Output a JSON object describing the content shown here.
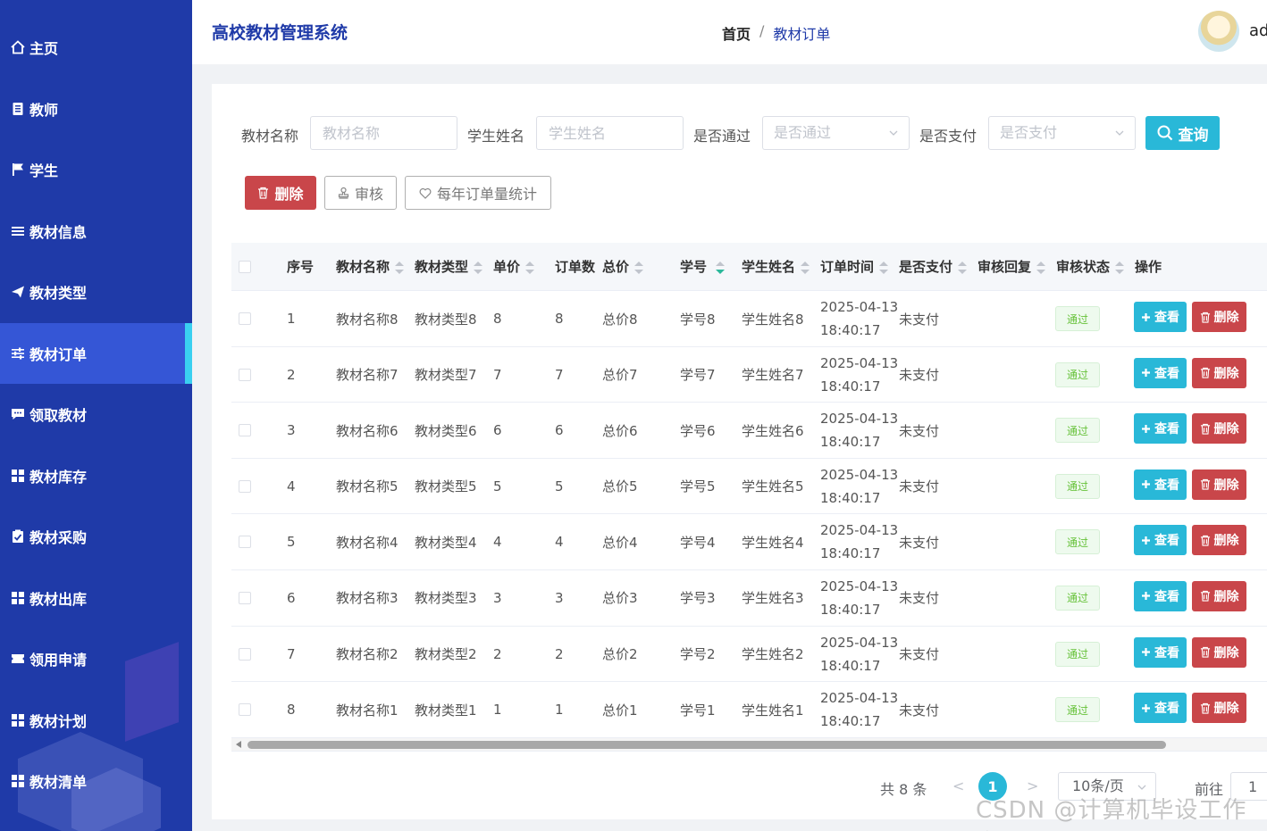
{
  "sidebar": {
    "items": [
      {
        "label": "主页",
        "icon": "home-icon"
      },
      {
        "label": "教师",
        "icon": "document-icon"
      },
      {
        "label": "学生",
        "icon": "flag-icon"
      },
      {
        "label": "教材信息",
        "icon": "list-icon"
      },
      {
        "label": "教材类型",
        "icon": "send-icon"
      },
      {
        "label": "教材订单",
        "icon": "sliders-icon",
        "active": true
      },
      {
        "label": "领取教材",
        "icon": "chat-icon"
      },
      {
        "label": "教材库存",
        "icon": "grid-icon"
      },
      {
        "label": "教材采购",
        "icon": "clipboard-check-icon"
      },
      {
        "label": "教材出库",
        "icon": "grid-icon"
      },
      {
        "label": "领用申请",
        "icon": "ticket-icon"
      },
      {
        "label": "教材计划",
        "icon": "grid-icon"
      },
      {
        "label": "教材清单",
        "icon": "grid-icon"
      }
    ]
  },
  "header": {
    "app_title": "高校教材管理系统",
    "breadcrumb_home": "首页",
    "breadcrumb_sep": "/",
    "breadcrumb_current": "教材订单",
    "user_name": "ad"
  },
  "search": {
    "book_name_label": "教材名称",
    "book_name_placeholder": "教材名称",
    "student_name_label": "学生姓名",
    "student_name_placeholder": "学生姓名",
    "passed_label": "是否通过",
    "passed_placeholder": "是否通过",
    "paid_label": "是否支付",
    "paid_placeholder": "是否支付",
    "search_button": "查询"
  },
  "actions": {
    "delete_label": "删除",
    "review_label": "审核",
    "stats_label": "每年订单量统计"
  },
  "table": {
    "headers": {
      "index": "序号",
      "book_name": "教材名称",
      "book_type": "教材类型",
      "unit_price": "单价",
      "quantity": "订单数",
      "total_price": "总价",
      "student_no": "学号",
      "student_name": "学生姓名",
      "order_time": "订单时间",
      "paid": "是否支付",
      "review_reply": "审核回复",
      "review_status": "审核状态",
      "operations": "操作"
    },
    "view_label": "查看",
    "delete_label": "删除",
    "rows": [
      {
        "index": "1",
        "book_name": "教材名称8",
        "book_type": "教材类型8",
        "unit_price": "8",
        "quantity": "8",
        "total_price": "总价8",
        "student_no": "学号8",
        "student_name": "学生姓名8",
        "date": "2025-04-13",
        "time": "18:40:17",
        "paid": "未支付",
        "status": "通过"
      },
      {
        "index": "2",
        "book_name": "教材名称7",
        "book_type": "教材类型7",
        "unit_price": "7",
        "quantity": "7",
        "total_price": "总价7",
        "student_no": "学号7",
        "student_name": "学生姓名7",
        "date": "2025-04-13",
        "time": "18:40:17",
        "paid": "未支付",
        "status": "通过"
      },
      {
        "index": "3",
        "book_name": "教材名称6",
        "book_type": "教材类型6",
        "unit_price": "6",
        "quantity": "6",
        "total_price": "总价6",
        "student_no": "学号6",
        "student_name": "学生姓名6",
        "date": "2025-04-13",
        "time": "18:40:17",
        "paid": "未支付",
        "status": "通过"
      },
      {
        "index": "4",
        "book_name": "教材名称5",
        "book_type": "教材类型5",
        "unit_price": "5",
        "quantity": "5",
        "total_price": "总价5",
        "student_no": "学号5",
        "student_name": "学生姓名5",
        "date": "2025-04-13",
        "time": "18:40:17",
        "paid": "未支付",
        "status": "通过"
      },
      {
        "index": "5",
        "book_name": "教材名称4",
        "book_type": "教材类型4",
        "unit_price": "4",
        "quantity": "4",
        "total_price": "总价4",
        "student_no": "学号4",
        "student_name": "学生姓名4",
        "date": "2025-04-13",
        "time": "18:40:17",
        "paid": "未支付",
        "status": "通过"
      },
      {
        "index": "6",
        "book_name": "教材名称3",
        "book_type": "教材类型3",
        "unit_price": "3",
        "quantity": "3",
        "total_price": "总价3",
        "student_no": "学号3",
        "student_name": "学生姓名3",
        "date": "2025-04-13",
        "time": "18:40:17",
        "paid": "未支付",
        "status": "通过"
      },
      {
        "index": "7",
        "book_name": "教材名称2",
        "book_type": "教材类型2",
        "unit_price": "2",
        "quantity": "2",
        "total_price": "总价2",
        "student_no": "学号2",
        "student_name": "学生姓名2",
        "date": "2025-04-13",
        "time": "18:40:17",
        "paid": "未支付",
        "status": "通过"
      },
      {
        "index": "8",
        "book_name": "教材名称1",
        "book_type": "教材类型1",
        "unit_price": "1",
        "quantity": "1",
        "total_price": "总价1",
        "student_no": "学号1",
        "student_name": "学生姓名1",
        "date": "2025-04-13",
        "time": "18:40:17",
        "paid": "未支付",
        "status": "通过"
      }
    ]
  },
  "pagination": {
    "total_text": "共 8 条",
    "prev": "<",
    "next": ">",
    "current_page": "1",
    "page_size": "10条/页",
    "goto_label": "前往",
    "goto_value": "1"
  },
  "watermark": "CSDN @计算机毕设工作室",
  "colors": {
    "sidebar_bg": "#1f3aa8",
    "accent": "#29b8d8",
    "danger": "#c9464a",
    "success": "#67c23a"
  }
}
